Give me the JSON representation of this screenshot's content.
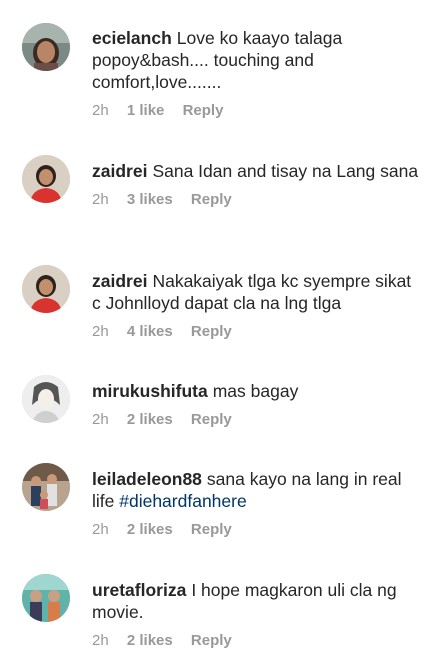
{
  "comments": [
    {
      "username": "ecielanch",
      "text": "Love ko kaayo talaga popoy&bash.... touching and comfort,love.......",
      "time": "2h",
      "likes": "1 like",
      "reply": "Reply",
      "avatar_icon": "woman-portrait-icon"
    },
    {
      "username": "zaidrei",
      "text": "Sana Idan and tisay na Lang sana",
      "time": "2h",
      "likes": "3 likes",
      "reply": "Reply",
      "avatar_icon": "woman-red-shirt-portrait-icon"
    },
    {
      "username": "zaidrei",
      "text": "Nakakaiyak tlga kc syempre sikat c Johnlloyd dapat cla na lng tlga",
      "time": "2h",
      "likes": "4 likes",
      "reply": "Reply",
      "avatar_icon": "woman-red-shirt-portrait-icon"
    },
    {
      "username": "mirukushifuta",
      "text": "mas bagay",
      "time": "2h",
      "likes": "2 likes",
      "reply": "Reply",
      "avatar_icon": "woman-sketch-portrait-icon"
    },
    {
      "username": "leiladeleon88",
      "text_before": "sana kayo na lang in real life ",
      "hashtag": "#diehardfanhere",
      "time": "2h",
      "likes": "2 likes",
      "reply": "Reply",
      "avatar_icon": "group-photo-icon"
    },
    {
      "username": "uretafloriza",
      "text": "I hope magkaron uli cla ng movie.",
      "time": "2h",
      "likes": "2 likes",
      "reply": "Reply",
      "avatar_icon": "people-outdoor-photo-icon"
    }
  ],
  "colors": {
    "text": "#262626",
    "meta": "#999999",
    "hashtag": "#003569"
  }
}
